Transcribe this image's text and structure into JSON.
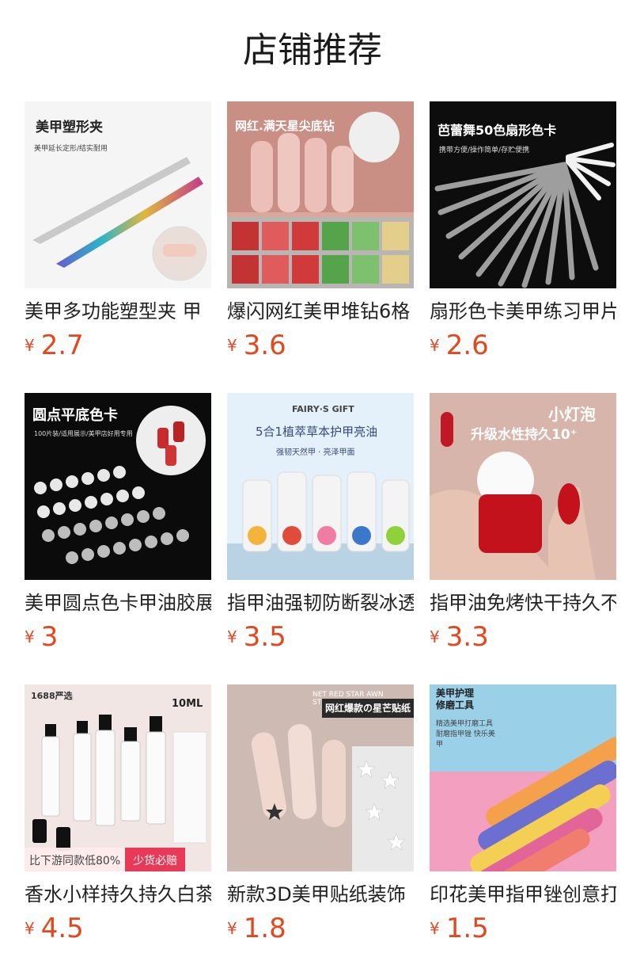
{
  "page": {
    "title": "店铺推荐"
  },
  "colors": {
    "price": "#e4471d",
    "text": "#222222",
    "background": "#ffffff"
  },
  "products": [
    {
      "name": "美甲多功能塑型夹 甲",
      "currency": "¥",
      "price": "2.7",
      "image": {
        "caption": "美甲塑形夹",
        "subcaption": "美甲延长定形/结实耐用"
      }
    },
    {
      "name": "爆闪网红美甲堆钻6格",
      "currency": "¥",
      "price": "3.6",
      "image": {
        "caption": "网红.满天星尖底钻",
        "subcaption": ""
      }
    },
    {
      "name": "扇形色卡美甲练习甲片",
      "currency": "¥",
      "price": "2.6",
      "image": {
        "caption": "芭蕾舞50色扇形色卡",
        "subcaption": "携带方便/操作简单/存贮便携"
      }
    },
    {
      "name": "美甲圆点色卡甲油胶展",
      "currency": "¥",
      "price": "3",
      "image": {
        "caption": "圆点平底色卡",
        "subcaption": "100片装/适用展示/美甲店好用专用"
      }
    },
    {
      "name": "指甲油强韧防断裂冰透",
      "currency": "¥",
      "price": "3.5",
      "image": {
        "caption": "5合1植萃草本护甲亮油",
        "subcaption": "强韧天然甲 · 亮泽甲面",
        "brand": "FAIRY·S GIFT"
      }
    },
    {
      "name": "指甲油免烤快干持久不",
      "currency": "¥",
      "price": "3.3",
      "image": {
        "caption": "小灯泡",
        "subcaption": "升级水性持久10⁺"
      }
    },
    {
      "name": "香水小样持久持久白茶",
      "currency": "¥",
      "price": "4.5",
      "image": {
        "caption": "10ML",
        "subcaption": "1688严选",
        "badge_left": "比下游同款低80%",
        "badge_right": "少货必赔"
      }
    },
    {
      "name": "新款3D美甲贴纸装饰",
      "currency": "¥",
      "price": "1.8",
      "image": {
        "caption": "网红爆款の星芒贴纸",
        "subcaption": "NET RED STAR AWN STICKER"
      }
    },
    {
      "name": "印花美甲指甲锉创意打",
      "currency": "¥",
      "price": "1.5",
      "image": {
        "caption": "美甲护理 修磨工具",
        "subcaption": "精选美甲打磨工具 耐磨指甲锉 快乐美甲"
      }
    }
  ]
}
